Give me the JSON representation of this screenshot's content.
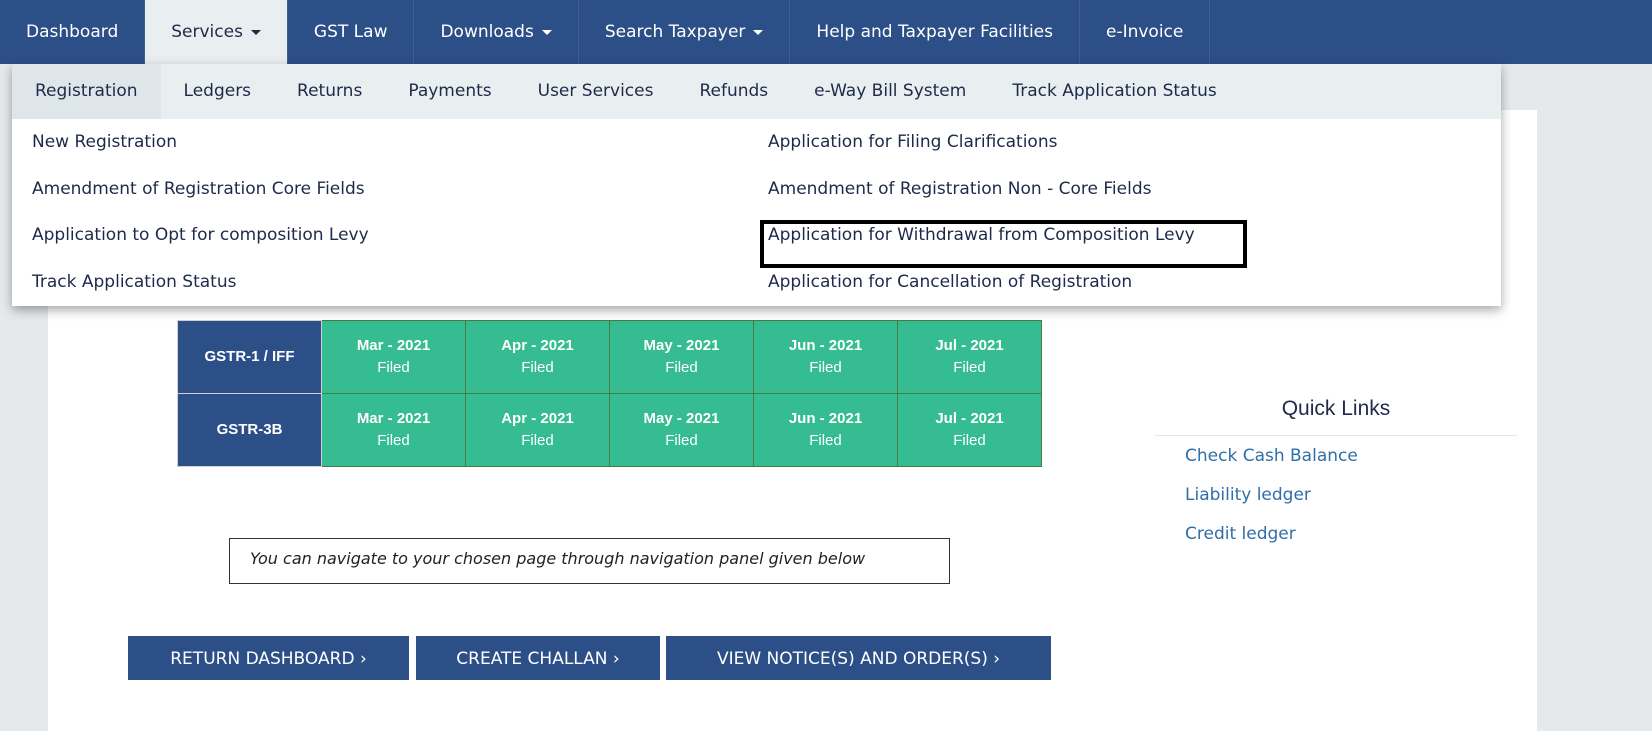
{
  "nav": {
    "items": [
      {
        "label": "Dashboard",
        "caret": false
      },
      {
        "label": "Services",
        "caret": true
      },
      {
        "label": "GST Law",
        "caret": false
      },
      {
        "label": "Downloads",
        "caret": true
      },
      {
        "label": "Search Taxpayer",
        "caret": true
      },
      {
        "label": "Help and Taxpayer Facilities",
        "caret": false
      },
      {
        "label": "e-Invoice",
        "caret": false
      }
    ],
    "active": "Services"
  },
  "services_menu": {
    "tabs": [
      "Registration",
      "Ledgers",
      "Returns",
      "Payments",
      "User Services",
      "Refunds",
      "e-Way Bill System",
      "Track Application Status"
    ],
    "active_tab": "Registration",
    "left_links": [
      "New Registration",
      "Amendment of Registration Core Fields",
      "Application to Opt for composition Levy",
      "Track Application Status"
    ],
    "right_links": [
      "Application for Filing Clarifications",
      "Amendment of Registration Non - Core Fields",
      "Application for Withdrawal from Composition Levy",
      "Application for Cancellation of Registration"
    ],
    "highlighted": "Amendment of Registration Non - Core Fields"
  },
  "returns_table": {
    "rows": [
      {
        "label": "GSTR-1 / IFF",
        "periods": [
          {
            "p": "Mar - 2021",
            "s": "Filed"
          },
          {
            "p": "Apr - 2021",
            "s": "Filed"
          },
          {
            "p": "May - 2021",
            "s": "Filed"
          },
          {
            "p": "Jun - 2021",
            "s": "Filed"
          },
          {
            "p": "Jul - 2021",
            "s": "Filed"
          }
        ]
      },
      {
        "label": "GSTR-3B",
        "periods": [
          {
            "p": "Mar - 2021",
            "s": "Filed"
          },
          {
            "p": "Apr - 2021",
            "s": "Filed"
          },
          {
            "p": "May - 2021",
            "s": "Filed"
          },
          {
            "p": "Jun - 2021",
            "s": "Filed"
          },
          {
            "p": "Jul - 2021",
            "s": "Filed"
          }
        ]
      }
    ]
  },
  "note": "You can navigate to your chosen page through navigation panel given below",
  "buttons": [
    "RETURN DASHBOARD ›",
    "CREATE CHALLAN ›",
    "VIEW NOTICE(S) AND ORDER(S) ›"
  ],
  "quick_links": {
    "title": "Quick Links",
    "items": [
      "Check Cash Balance",
      "Liability ledger",
      "Credit ledger"
    ]
  },
  "colors": {
    "nav": "#2c4f87",
    "filed": "#36bc91",
    "link": "#2f6ea9"
  }
}
